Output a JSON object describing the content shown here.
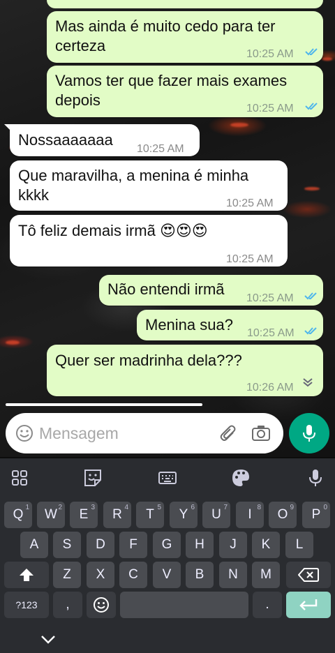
{
  "messages": [
    {
      "dir": "out",
      "text_lines": [
        "Mas ainda é muito cedo para ter",
        "certeza"
      ],
      "time": "10:25 AM",
      "status": "read"
    },
    {
      "dir": "out",
      "text_lines": [
        "Vamos ter que fazer mais exames",
        "depois"
      ],
      "time": "10:25 AM",
      "status": "read"
    },
    {
      "dir": "in",
      "text_lines": [
        "Nossaaaaaaa"
      ],
      "time": "10:25 AM"
    },
    {
      "dir": "in",
      "text_lines": [
        "Que maravilha, a menina é minha",
        "kkkk"
      ],
      "time": "10:25 AM"
    },
    {
      "dir": "in",
      "text_lines": [
        "Tô feliz demais irmã 😍😍😍"
      ],
      "time": "10:25 AM"
    },
    {
      "dir": "out",
      "text_lines": [
        "Não entendi irmã"
      ],
      "time": "10:25 AM",
      "status": "read"
    },
    {
      "dir": "out",
      "text_lines": [
        "Menina sua?"
      ],
      "time": "10:25 AM",
      "status": "read"
    },
    {
      "dir": "out",
      "text_lines": [
        "Quer ser madrinha dela???"
      ],
      "time": "10:26 AM"
    }
  ],
  "composer": {
    "placeholder": "Mensagem"
  },
  "colors": {
    "out_bubble": "#e2fcc6",
    "in_bubble": "#ffffff",
    "read_tick": "#4fb6ec",
    "accent": "#00a884"
  },
  "keyboard": {
    "row1": [
      {
        "k": "Q",
        "s": "1"
      },
      {
        "k": "W",
        "s": "2"
      },
      {
        "k": "E",
        "s": "3"
      },
      {
        "k": "R",
        "s": "4"
      },
      {
        "k": "T",
        "s": "5"
      },
      {
        "k": "Y",
        "s": "6"
      },
      {
        "k": "U",
        "s": "7"
      },
      {
        "k": "I",
        "s": "8"
      },
      {
        "k": "O",
        "s": "9"
      },
      {
        "k": "P",
        "s": "0"
      }
    ],
    "row2": [
      "A",
      "S",
      "D",
      "F",
      "G",
      "H",
      "J",
      "K",
      "L"
    ],
    "row3": [
      "Z",
      "X",
      "C",
      "V",
      "B",
      "N",
      "M"
    ],
    "symbols_label": "?123",
    "comma": ",",
    "period": "."
  }
}
